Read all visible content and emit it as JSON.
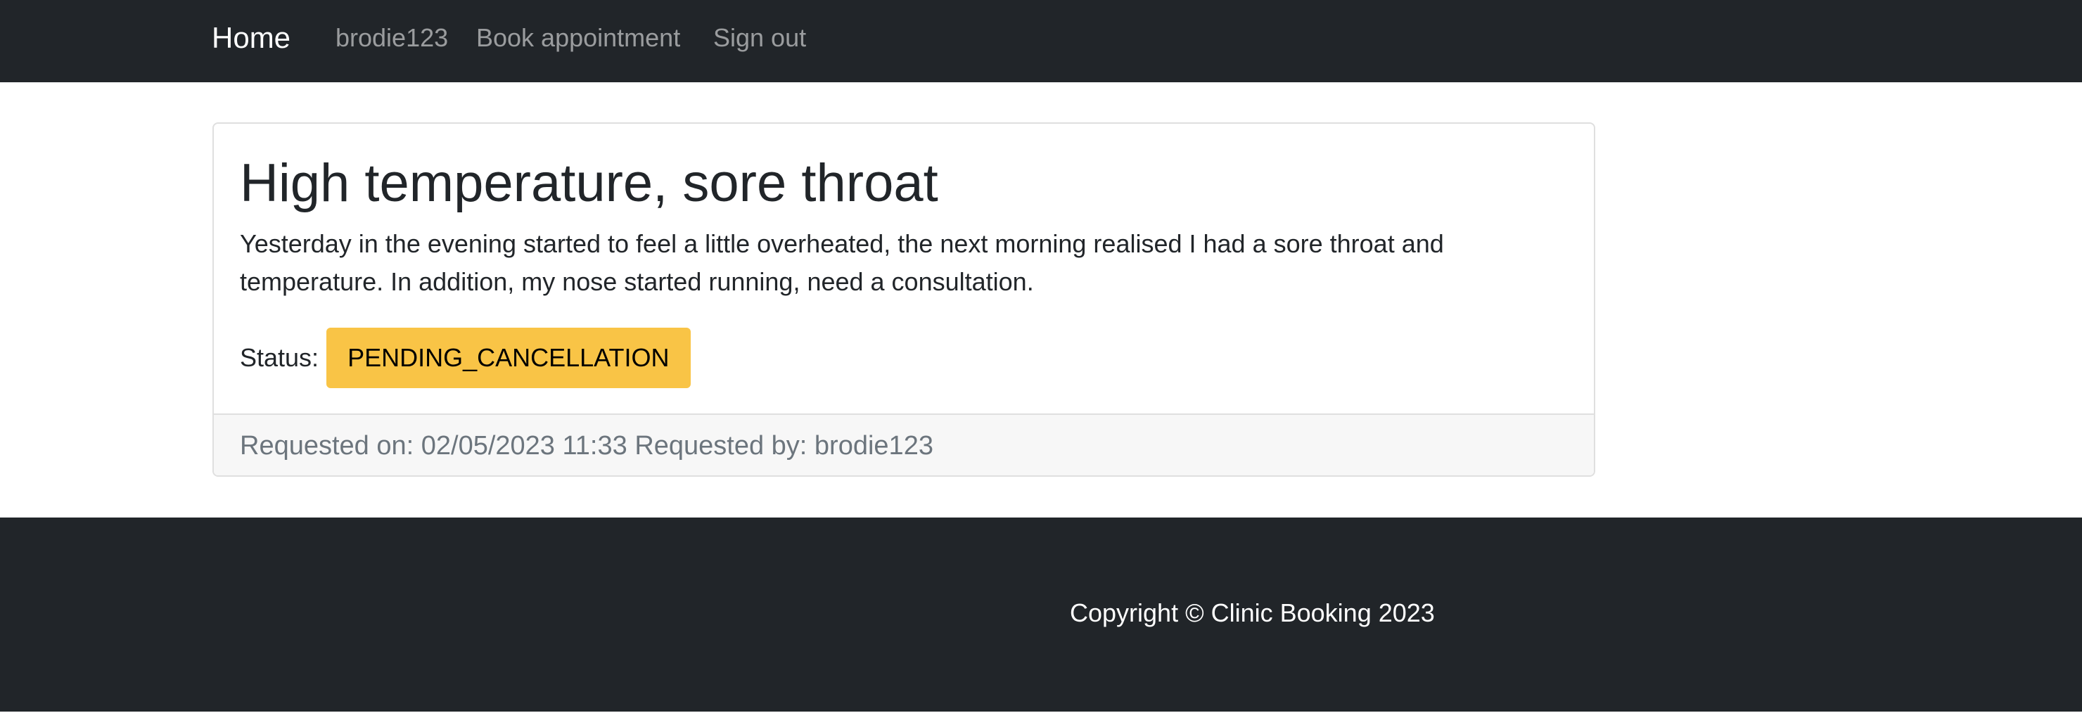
{
  "navbar": {
    "brand": "Home",
    "links": {
      "user": "brodie123",
      "book": "Book appointment",
      "signout": "Sign out"
    },
    "background": "#212529"
  },
  "appointment": {
    "title": "High temperature, sore throat",
    "description": "Yesterday in the evening started to feel a little overheated, the next morning realised I had a sore throat and temperature. In addition, my nose started running, need a consultation.",
    "status_label": "Status:",
    "status": "PENDING_CANCELLATION",
    "status_color": "#f9c446",
    "footer": "Requested on: 02/05/2023 11:33 Requested by: brodie123"
  },
  "footer": {
    "copyright": "Copyright © Clinic Booking 2023"
  }
}
